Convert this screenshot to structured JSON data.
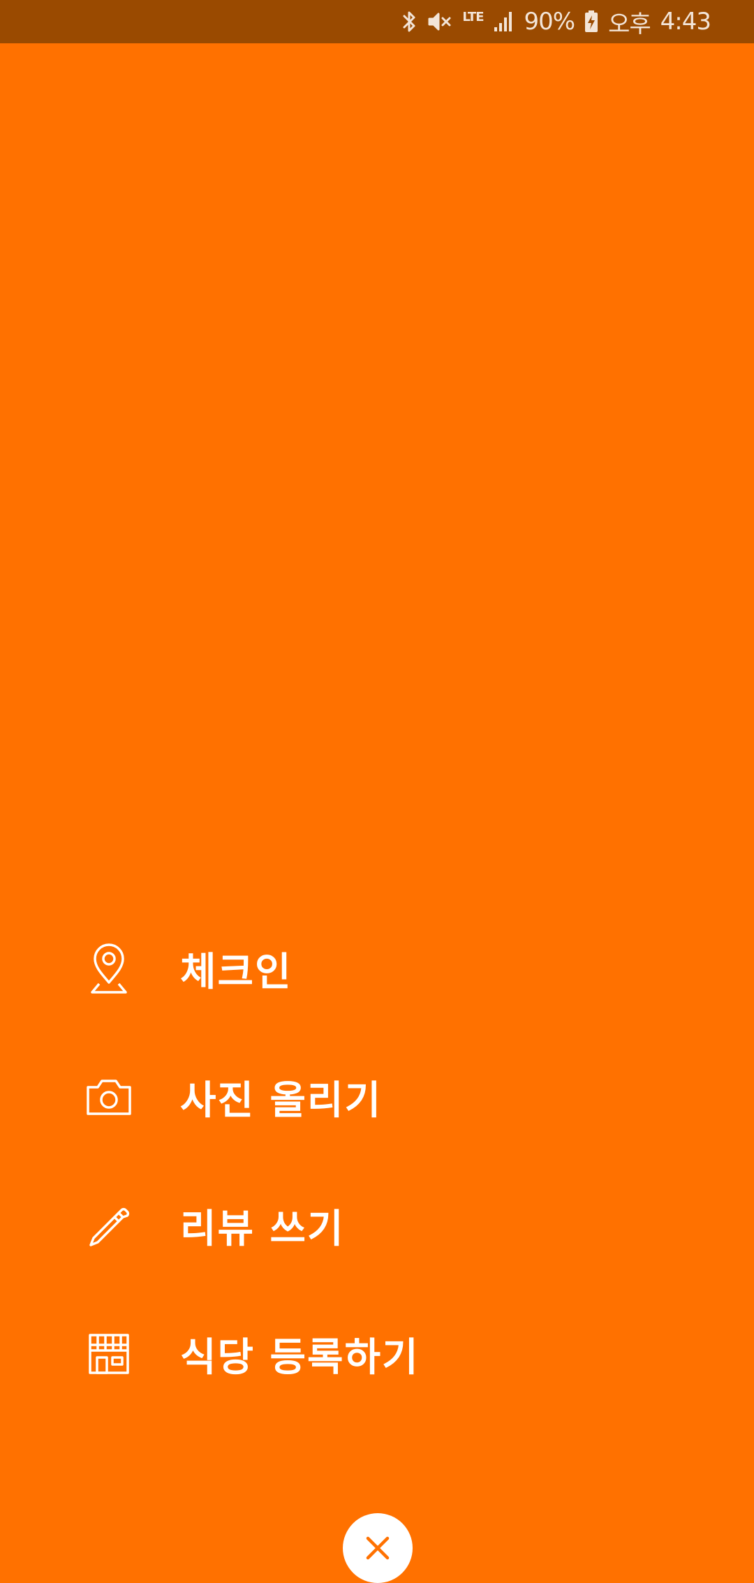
{
  "status_bar": {
    "lte": "LTE",
    "battery_percent": "90%",
    "ampm": "오후",
    "time": "4:43",
    "icons": [
      "bluetooth-icon",
      "vibrate-mute-icon",
      "lte-icon",
      "signal-icon",
      "battery-charging-icon"
    ]
  },
  "menu": {
    "items": [
      {
        "id": "checkin",
        "label": "체크인",
        "icon": "map-pin-icon"
      },
      {
        "id": "upload-photo",
        "label": "사진 올리기",
        "icon": "camera-icon"
      },
      {
        "id": "write-review",
        "label": "리뷰 쓰기",
        "icon": "pencil-icon"
      },
      {
        "id": "register-restaurant",
        "label": "식당 등록하기",
        "icon": "storefront-icon"
      }
    ]
  },
  "close_button": {
    "icon": "close-icon"
  },
  "colors": {
    "background": "#FF7100",
    "status_bar": "#9A4A00",
    "text": "#FFFFFF",
    "close_icon": "#FF7100"
  }
}
